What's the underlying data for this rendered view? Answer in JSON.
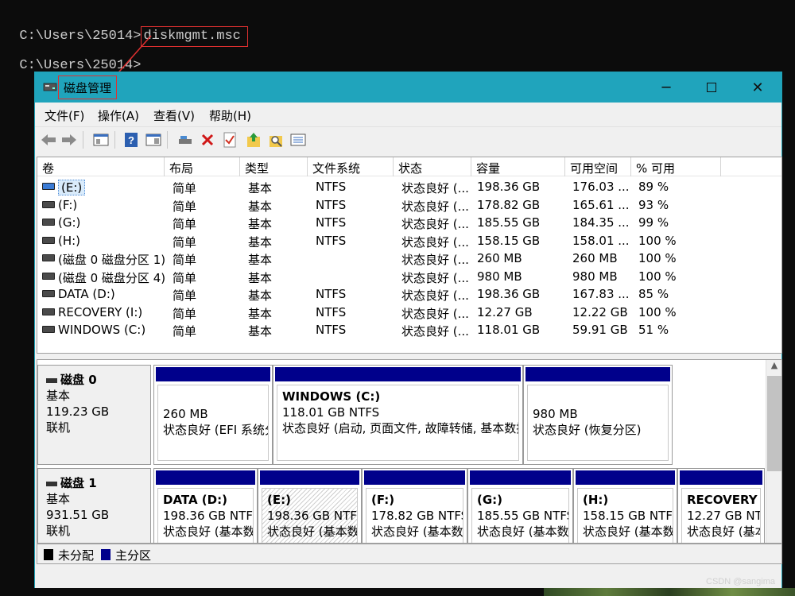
{
  "console": {
    "line1_prompt": "C:\\Users\\25014>",
    "line1_command": "diskmgmt.msc",
    "line2_prompt": "C:\\Users\\25014>"
  },
  "window": {
    "title": "磁盘管理",
    "controls": {
      "minimize": "─",
      "maximize": "☐",
      "close": "✕"
    }
  },
  "menu": [
    "文件(F)",
    "操作(A)",
    "查看(V)",
    "帮助(H)"
  ],
  "toolbar_icons": [
    "back-arrow-icon",
    "forward-arrow-icon",
    "properties-panel-icon",
    "help-icon",
    "show-hide-pane-icon",
    "connect-drive-icon",
    "delete-icon",
    "check-icon",
    "up-arrow-folder-icon",
    "search-folder-icon",
    "list-icon"
  ],
  "volume_columns": [
    "卷",
    "布局",
    "类型",
    "文件系统",
    "状态",
    "容量",
    "可用空间",
    "% 可用"
  ],
  "volumes": [
    {
      "name": "(E:)",
      "layout": "简单",
      "type": "基本",
      "fs": "NTFS",
      "status": "状态良好 (...",
      "capacity": "198.36 GB",
      "free": "176.03 ...",
      "pct": "89 %",
      "icon": "drive-icon-blue",
      "selected": true
    },
    {
      "name": "(F:)",
      "layout": "简单",
      "type": "基本",
      "fs": "NTFS",
      "status": "状态良好 (...",
      "capacity": "178.82 GB",
      "free": "165.61 ...",
      "pct": "93 %",
      "icon": "drive-icon-dark"
    },
    {
      "name": "(G:)",
      "layout": "简单",
      "type": "基本",
      "fs": "NTFS",
      "status": "状态良好 (...",
      "capacity": "185.55 GB",
      "free": "184.35 ...",
      "pct": "99 %",
      "icon": "drive-icon-dark"
    },
    {
      "name": "(H:)",
      "layout": "简单",
      "type": "基本",
      "fs": "NTFS",
      "status": "状态良好 (...",
      "capacity": "158.15 GB",
      "free": "158.01 ...",
      "pct": "100 %",
      "icon": "drive-icon-dark"
    },
    {
      "name": "(磁盘 0 磁盘分区 1)",
      "layout": "简单",
      "type": "基本",
      "fs": "",
      "status": "状态良好 (...",
      "capacity": "260 MB",
      "free": "260 MB",
      "pct": "100 %",
      "icon": "drive-icon-dark"
    },
    {
      "name": "(磁盘 0 磁盘分区 4)",
      "layout": "简单",
      "type": "基本",
      "fs": "",
      "status": "状态良好 (...",
      "capacity": "980 MB",
      "free": "980 MB",
      "pct": "100 %",
      "icon": "drive-icon-dark"
    },
    {
      "name": "DATA (D:)",
      "layout": "简单",
      "type": "基本",
      "fs": "NTFS",
      "status": "状态良好 (...",
      "capacity": "198.36 GB",
      "free": "167.83 ...",
      "pct": "85 %",
      "icon": "drive-icon-dark"
    },
    {
      "name": "RECOVERY (I:)",
      "layout": "简单",
      "type": "基本",
      "fs": "NTFS",
      "status": "状态良好 (...",
      "capacity": "12.27 GB",
      "free": "12.22 GB",
      "pct": "100 %",
      "icon": "drive-icon-dark"
    },
    {
      "name": "WINDOWS (C:)",
      "layout": "简单",
      "type": "基本",
      "fs": "NTFS",
      "status": "状态良好 (...",
      "capacity": "118.01 GB",
      "free": "59.91 GB",
      "pct": "51 %",
      "icon": "drive-icon-dark"
    }
  ],
  "disks": [
    {
      "name": "磁盘 0",
      "kind": "基本",
      "size": "119.23 GB",
      "state": "联机",
      "partitions": [
        {
          "title": "",
          "size": "260 MB",
          "status": "状态良好 (EFI 系统分"
        },
        {
          "title": "WINDOWS  (C:)",
          "size": "118.01 GB NTFS",
          "status": "状态良好 (启动, 页面文件, 故障转储, 基本数据"
        },
        {
          "title": "",
          "size": "980 MB",
          "status": "状态良好 (恢复分区)"
        }
      ]
    },
    {
      "name": "磁盘 1",
      "kind": "基本",
      "size": "931.51 GB",
      "state": "联机",
      "partitions": [
        {
          "title": "DATA  (D:)",
          "size": "198.36 GB NTFS",
          "status": "状态良好 (基本数"
        },
        {
          "title": "(E:)",
          "size": "198.36 GB NTFS",
          "status": "状态良好 (基本数",
          "selected": true
        },
        {
          "title": "(F:)",
          "size": "178.82 GB NTFS",
          "status": "状态良好 (基本数"
        },
        {
          "title": "(G:)",
          "size": "185.55 GB NTFS",
          "status": "状态良好 (基本数"
        },
        {
          "title": "(H:)",
          "size": "158.15 GB NTFS",
          "status": "状态良好 (基本数"
        },
        {
          "title": "RECOVERY",
          "size": "12.27 GB NT",
          "status": "状态良好 (基本"
        }
      ]
    }
  ],
  "legend": [
    {
      "label": "未分配",
      "color": "#000000"
    },
    {
      "label": "主分区",
      "color": "#00008b"
    }
  ],
  "watermark": "CSDN @sangima",
  "colors": {
    "titlebar": "#20a4bc",
    "partition_bar": "#00008b",
    "highlight": "#e03030"
  }
}
